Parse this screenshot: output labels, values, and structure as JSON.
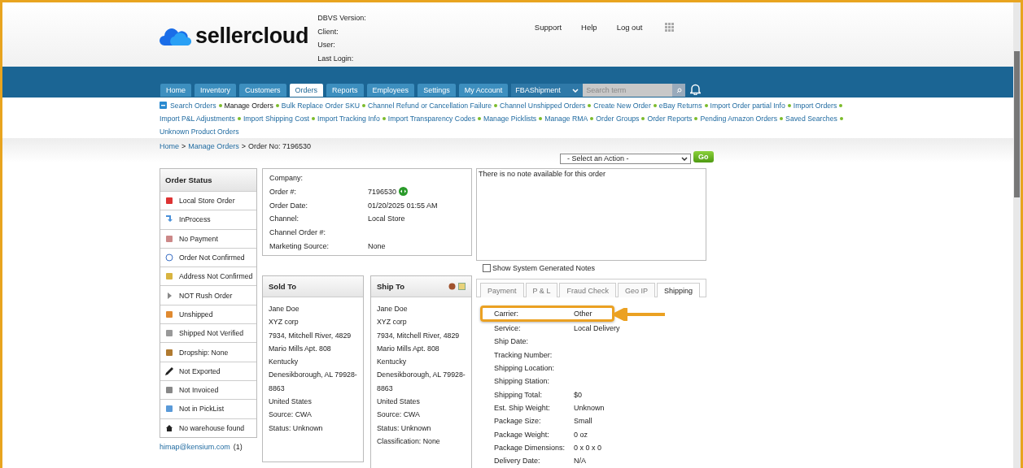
{
  "header": {
    "logo_text": "sellercloud",
    "info_labels": [
      "DBVS Version:",
      "Client:",
      "User:",
      "Last Login:"
    ],
    "links": [
      "Support",
      "Help",
      "Log out"
    ]
  },
  "nav": {
    "tabs": [
      {
        "label": "Home",
        "selected": false
      },
      {
        "label": "Inventory",
        "selected": false
      },
      {
        "label": "Customers",
        "selected": false
      },
      {
        "label": "Orders",
        "selected": true
      },
      {
        "label": "Reports",
        "selected": false
      },
      {
        "label": "Employees",
        "selected": false
      },
      {
        "label": "Settings",
        "selected": false
      },
      {
        "label": "My Account",
        "selected": false
      }
    ],
    "dropdown": "FBAShipment",
    "search_placeholder": "Search term"
  },
  "sub_links": [
    {
      "label": "Search Orders",
      "current": false
    },
    {
      "label": "Manage Orders",
      "current": true
    },
    {
      "label": "Bulk Replace Order SKU",
      "current": false
    },
    {
      "label": "Channel Refund or Cancellation Failure",
      "current": false
    },
    {
      "label": "Channel Unshipped Orders",
      "current": false
    },
    {
      "label": "Create New Order",
      "current": false
    },
    {
      "label": "eBay Returns",
      "current": false
    },
    {
      "label": "Import Order partial Info",
      "current": false
    },
    {
      "label": "Import Orders",
      "current": false
    },
    {
      "label": "Import P&L Adjustments",
      "current": false
    },
    {
      "label": "Import Shipping Cost",
      "current": false
    },
    {
      "label": "Import Tracking Info",
      "current": false
    },
    {
      "label": "Import Transparency Codes",
      "current": false
    },
    {
      "label": "Manage Picklists",
      "current": false
    },
    {
      "label": "Manage RMA",
      "current": false
    },
    {
      "label": "Order Groups",
      "current": false
    },
    {
      "label": "Order Reports",
      "current": false
    },
    {
      "label": "Pending Amazon Orders",
      "current": false
    },
    {
      "label": "Saved Searches",
      "current": false
    },
    {
      "label": "Unknown Product Orders",
      "current": false
    }
  ],
  "breadcrumb": [
    "Home",
    "Manage Orders",
    "Order No: 7196530"
  ],
  "breadcrumb_separator": ">",
  "action": {
    "select": "- Select an Action -",
    "button": "Go"
  },
  "order_status": {
    "title": "Order Status",
    "items": [
      {
        "label": "Local Store Order",
        "kind": "store"
      },
      {
        "label": "InProcess",
        "kind": "arrow"
      },
      {
        "label": "No Payment",
        "kind": "payment"
      },
      {
        "label": "Order Not Confirmed",
        "kind": "info"
      },
      {
        "label": "Address Not Confirmed",
        "kind": "address"
      },
      {
        "label": "NOT Rush Order",
        "kind": "play"
      },
      {
        "label": "Unshipped",
        "kind": "box"
      },
      {
        "label": "Shipped Not Verified",
        "kind": "truck"
      },
      {
        "label": "Dropship: None",
        "kind": "dropship"
      },
      {
        "label": "Not Exported",
        "kind": "pen"
      },
      {
        "label": "Not Invoiced",
        "kind": "invoice"
      },
      {
        "label": "Not in PickList",
        "kind": "picklist"
      },
      {
        "label": "No warehouse found",
        "kind": "home"
      }
    ],
    "user_link": "himap@kensium.com",
    "user_count": "(1)"
  },
  "order_info": [
    {
      "label": "Company:"
    },
    {
      "label": "Order #:",
      "value": "7196530"
    },
    {
      "label": "Order Date:",
      "value": "01/20/2025 01:55 AM"
    },
    {
      "label": "Channel:",
      "value": "Local Store"
    },
    {
      "label": "Channel Order #:"
    },
    {
      "label": "Marketing Source:",
      "value": "None"
    }
  ],
  "notes": {
    "text": "There is no note available for this order",
    "checkbox_label": "Show System Generated Notes",
    "checked": false
  },
  "sold_to": {
    "title": "Sold To",
    "lines": [
      "Jane Doe",
      "XYZ corp",
      "7934, Mitchell River, 4829",
      "Mario Mills Apt. 808",
      "Kentucky",
      "Denesikborough, AL 79928-",
      "8863",
      "United States",
      "Source: CWA",
      "Status: Unknown"
    ]
  },
  "ship_to": {
    "title": "Ship To",
    "lines": [
      "Jane Doe",
      "XYZ corp",
      "7934, Mitchell River, 4829",
      "Mario Mills Apt. 808",
      "Kentucky",
      "Denesikborough, AL 79928-",
      "8863",
      "United States",
      "Source: CWA",
      "Status: Unknown",
      "Classification: None"
    ]
  },
  "detail_tabs": [
    {
      "label": "Payment",
      "selected": false
    },
    {
      "label": "P & L",
      "selected": false
    },
    {
      "label": "Fraud Check",
      "selected": false
    },
    {
      "label": "Geo IP",
      "selected": false
    },
    {
      "label": "Shipping",
      "selected": true
    }
  ],
  "shipping": [
    {
      "label": "Carrier:",
      "value": "Other",
      "highlighted": true
    },
    {
      "label": "Service:",
      "value": "Local Delivery",
      "highlighted": false
    },
    {
      "label": "Ship Date:",
      "highlighted": false
    },
    {
      "label": "Tracking Number:",
      "highlighted": false
    },
    {
      "label": "Shipping Location:",
      "highlighted": false
    },
    {
      "label": "Shipping Station:",
      "highlighted": false
    },
    {
      "label": "Shipping Total:",
      "value": "$0",
      "highlighted": false
    },
    {
      "label": "Est. Ship Weight:",
      "value": "Unknown",
      "highlighted": false
    },
    {
      "label": "Package Size:",
      "value": "Small",
      "highlighted": false
    },
    {
      "label": "Package Weight:",
      "value": "0 oz",
      "highlighted": false
    },
    {
      "label": "Package Dimensions:",
      "value": "0 x 0 x 0",
      "highlighted": false
    },
    {
      "label": "Delivery Date:",
      "value": "N/A",
      "highlighted": false
    }
  ]
}
